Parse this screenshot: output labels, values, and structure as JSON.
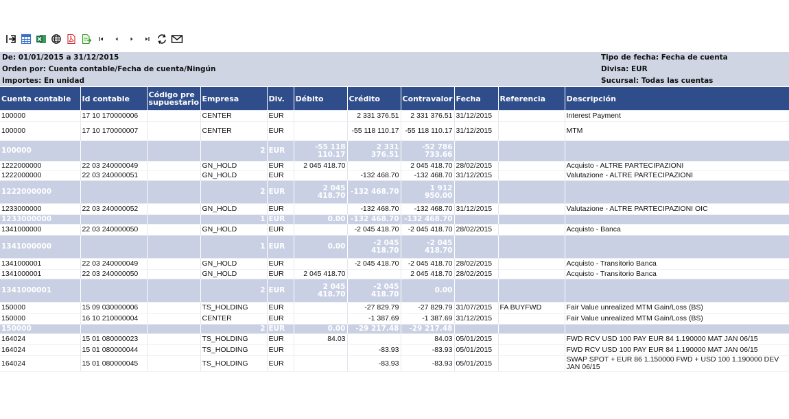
{
  "toolbar": [
    {
      "name": "export-icon",
      "title": "Exportar"
    },
    {
      "name": "grid-icon",
      "title": "Tabla"
    },
    {
      "name": "excel-icon",
      "title": "Excel"
    },
    {
      "name": "globe-icon",
      "title": "Web"
    },
    {
      "name": "pdf-icon",
      "title": "PDF"
    },
    {
      "name": "document-export-icon",
      "title": "Documento"
    },
    {
      "name": "first-page-icon",
      "title": "Primera"
    },
    {
      "name": "previous-page-icon",
      "title": "Anterior"
    },
    {
      "name": "next-page-icon",
      "title": "Siguiente"
    },
    {
      "name": "last-page-icon",
      "title": "Última"
    },
    {
      "name": "refresh-icon",
      "title": "Actualizar"
    },
    {
      "name": "email-icon",
      "title": "Correo"
    }
  ],
  "header": {
    "period": "De: 01/01/2015 a 31/12/2015",
    "order": "Orden por: Cuenta contable/Fecha de cuenta/Ningún",
    "amounts": "Importes: En unidad",
    "date_type": "Tipo de fecha: Fecha de cuenta",
    "currency": "Divisa: EUR",
    "branch": "Sucursal: Todas las cuentas"
  },
  "columns": [
    "Cuenta contable",
    "Id contable",
    "Código pre supuestario",
    "Empresa",
    "Div.",
    "Débito",
    "Crédito",
    "Contravalor",
    "Fecha",
    "Referencia",
    "Descripción"
  ],
  "rows": [
    {
      "type": "detail",
      "cuenta": "100000",
      "id": "17 10 170000006",
      "codigo": "",
      "empresa": "CENTER",
      "div": "EUR",
      "debito": "",
      "credito": "2 331 376.51",
      "contravalor": "2 331 376.51",
      "fecha": "31/12/2015",
      "referencia": "",
      "descripcion": "Interest Payment"
    },
    {
      "type": "detail",
      "cuenta": "100000",
      "id": "17 10 170000007",
      "codigo": "",
      "empresa": "CENTER",
      "div": "EUR",
      "debito": "",
      "credito": "-55 118 110.17",
      "contravalor": "-55 118 110.17",
      "fecha": "31/12/2015",
      "referencia": "",
      "descripcion": "MTM"
    },
    {
      "type": "subtotal",
      "cuenta": "100000",
      "count": "2",
      "div": "EUR",
      "debito": "-55 118 110.17",
      "credito": "2 331 376.51",
      "contravalor": "-52 786 733.66"
    },
    {
      "type": "detail",
      "cuenta": "1222000000",
      "id": "22 03 240000049",
      "codigo": "",
      "empresa": "GN_HOLD",
      "div": "EUR",
      "debito": "2 045 418.70",
      "credito": "",
      "contravalor": "2 045 418.70",
      "fecha": "28/02/2015",
      "referencia": "",
      "descripcion": "Acquisto - ALTRE PARTECIPAZIONI"
    },
    {
      "type": "detail",
      "cuenta": "1222000000",
      "id": "22 03 240000051",
      "codigo": "",
      "empresa": "GN_HOLD",
      "div": "EUR",
      "debito": "",
      "credito": "-132 468.70",
      "contravalor": "-132 468.70",
      "fecha": "31/12/2015",
      "referencia": "",
      "descripcion": "Valutazione - ALTRE PARTECIPAZIONI"
    },
    {
      "type": "subtotal",
      "cuenta": "1222000000",
      "count": "2",
      "div": "EUR",
      "debito": "2 045 418.70",
      "credito": "-132 468.70",
      "contravalor": "1 912 950.00"
    },
    {
      "type": "detail",
      "cuenta": "1233000000",
      "id": "22 03 240000052",
      "codigo": "",
      "empresa": "GN_HOLD",
      "div": "EUR",
      "debito": "",
      "credito": "-132 468.70",
      "contravalor": "-132 468.70",
      "fecha": "31/12/2015",
      "referencia": "",
      "descripcion": "Valutazione - ALTRE PARTECIPAZIONI OIC"
    },
    {
      "type": "subtotal",
      "cuenta": "1233000000",
      "count": "1",
      "div": "EUR",
      "debito": "0.00",
      "credito": "-132 468.70",
      "contravalor": "-132 468.70"
    },
    {
      "type": "detail",
      "cuenta": "1341000000",
      "id": "22 03 240000050",
      "codigo": "",
      "empresa": "GN_HOLD",
      "div": "EUR",
      "debito": "",
      "credito": "-2 045 418.70",
      "contravalor": "-2 045 418.70",
      "fecha": "28/02/2015",
      "referencia": "",
      "descripcion": "Acquisto - Banca"
    },
    {
      "type": "subtotal",
      "cuenta": "1341000000",
      "count": "1",
      "div": "EUR",
      "debito": "0.00",
      "credito": "-2 045 418.70",
      "contravalor": "-2 045 418.70"
    },
    {
      "type": "detail",
      "cuenta": "1341000001",
      "id": "22 03 240000049",
      "codigo": "",
      "empresa": "GN_HOLD",
      "div": "EUR",
      "debito": "",
      "credito": "-2 045 418.70",
      "contravalor": "-2 045 418.70",
      "fecha": "28/02/2015",
      "referencia": "",
      "descripcion": "Acquisto - Transitorio Banca"
    },
    {
      "type": "detail",
      "cuenta": "1341000001",
      "id": "22 03 240000050",
      "codigo": "",
      "empresa": "GN_HOLD",
      "div": "EUR",
      "debito": "2 045 418.70",
      "credito": "",
      "contravalor": "2 045 418.70",
      "fecha": "28/02/2015",
      "referencia": "",
      "descripcion": "Acquisto - Transitorio Banca"
    },
    {
      "type": "subtotal",
      "cuenta": "1341000001",
      "count": "2",
      "div": "EUR",
      "debito": "2 045 418.70",
      "credito": "-2 045 418.70",
      "contravalor": "0.00"
    },
    {
      "type": "detail",
      "cuenta": "150000",
      "id": "15 09 030000006",
      "codigo": "",
      "empresa": "TS_HOLDING",
      "div": "EUR",
      "debito": "",
      "credito": "-27 829.79",
      "contravalor": "-27 829.79",
      "fecha": "31/07/2015",
      "referencia": "FA BUYFWD",
      "descripcion": "Fair Value unrealized MTM Gain/Loss (BS)"
    },
    {
      "type": "detail",
      "cuenta": "150000",
      "id": "16 10 210000004",
      "codigo": "",
      "empresa": "CENTER",
      "div": "EUR",
      "debito": "",
      "credito": "-1 387.69",
      "contravalor": "-1 387.69",
      "fecha": "31/12/2015",
      "referencia": "",
      "descripcion": "Fair Value unrealized MTM Gain/Loss (BS)"
    },
    {
      "type": "subtotal",
      "cuenta": "150000",
      "count": "2",
      "div": "EUR",
      "debito": "0.00",
      "credito": "-29 217.48",
      "contravalor": "-29 217.48"
    },
    {
      "type": "detail",
      "cuenta": "164024",
      "id": "15 01 080000023",
      "codigo": "",
      "empresa": "TS_HOLDING",
      "div": "EUR",
      "debito": "84.03",
      "credito": "",
      "contravalor": "84.03",
      "fecha": "05/01/2015",
      "referencia": "",
      "descripcion": "FWD RCV USD 100  PAY EUR 84  1.190000 MAT JAN 06/15"
    },
    {
      "type": "detail",
      "cuenta": "164024",
      "id": "15 01 080000044",
      "codigo": "",
      "empresa": "TS_HOLDING",
      "div": "EUR",
      "debito": "",
      "credito": "-83.93",
      "contravalor": "-83.93",
      "fecha": "05/01/2015",
      "referencia": "",
      "descripcion": "FWD RCV USD 100  PAY EUR 84  1.190000 MAT JAN 06/15"
    },
    {
      "type": "detail",
      "cuenta": "164024",
      "id": "15 01 080000045",
      "codigo": "",
      "empresa": "TS_HOLDING",
      "div": "EUR",
      "debito": "",
      "credito": "-83.93",
      "contravalor": "-83.93",
      "fecha": "05/01/2015",
      "referencia": "",
      "descripcion": "SWAP SPOT + EUR 86  1.150000 FWD + USD 100  1.190000 DEV JAN 06/15"
    }
  ]
}
